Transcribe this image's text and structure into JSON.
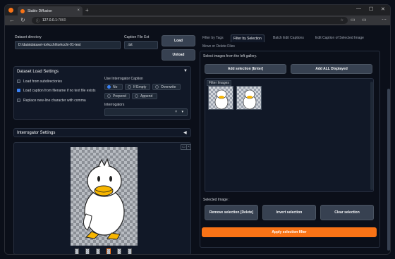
{
  "browser": {
    "tab_title": "Stable Diffusion",
    "url_host": "127.0.0.1",
    "url_port": ":7860",
    "new_tab": "+",
    "tab_close": "×",
    "win_min": "—",
    "win_max": "☐",
    "win_close": "✕"
  },
  "left": {
    "dataset_dir_label": "Dataset directory",
    "dataset_dir_value": "D:\\data\\dataset-torkcchi\\torkcchi-01-test",
    "caption_ext_label": "Caption File Ext",
    "caption_ext_value": ".txt",
    "load_btn": "Load",
    "unload_btn": "Unload",
    "load_settings_title": "Dataset Load Settings",
    "load_subdirs": "Load from subdirectories",
    "load_caption_filename": "Load caption from filename if no text file exists",
    "replace_newline": "Replace new-line character with comma",
    "use_interrogator_label": "Use Interrogator Caption",
    "radio_no": "No",
    "radio_if_empty": "If Empty",
    "radio_overwrite": "Overwrite",
    "radio_prepend": "Prepend",
    "radio_append": "Append",
    "interrogators_label": "Interrogators",
    "interrogator_settings_title": "Interrogator Settings"
  },
  "right": {
    "tabs": [
      "Filter by Tags",
      "Filter by Selection",
      "Batch Edit Captions",
      "Edit Caption of Selected Image",
      "Move or Delete Files"
    ],
    "select_hint": "Select images from the left gallery.",
    "add_selection": "Add selection [Enter]",
    "add_all": "Add ALL Displayed",
    "filter_images_label": "Filter Images",
    "selected_image_label": "Selected Image :",
    "remove_selection": "Remove selection [Delete]",
    "invert_selection": "Invert selection",
    "clear_selection": "Clear selection",
    "apply_filter": "Apply selection filter"
  },
  "icons": {
    "collapse_down": "▼",
    "collapse_left": "◀",
    "dropdown": "▾",
    "clear_x": "×",
    "back": "←",
    "reload": "↻",
    "info": "ⓘ",
    "star": "☆",
    "reader": "▭",
    "menu": "⋯"
  },
  "colors": {
    "accent": "#f97316",
    "checkbox": "#3b82f6"
  }
}
